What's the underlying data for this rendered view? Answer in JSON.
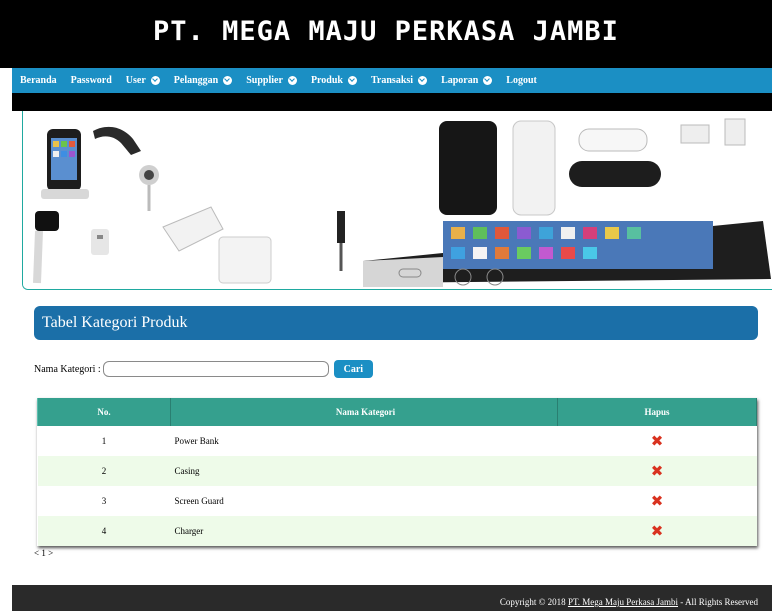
{
  "site_title": "PT. MEGA MAJU PERKASA JAMBI",
  "nav": [
    {
      "label": "Beranda",
      "dropdown": false
    },
    {
      "label": "Password",
      "dropdown": false
    },
    {
      "label": "User",
      "dropdown": true
    },
    {
      "label": "Pelanggan",
      "dropdown": true
    },
    {
      "label": "Supplier",
      "dropdown": true
    },
    {
      "label": "Produk",
      "dropdown": true
    },
    {
      "label": "Transaksi",
      "dropdown": true
    },
    {
      "label": "Laporan",
      "dropdown": true
    },
    {
      "label": "Logout",
      "dropdown": false
    }
  ],
  "panel_title": "Tabel Kategori Produk",
  "search": {
    "label": "Nama Kategori :",
    "value": "",
    "button": "Cari"
  },
  "table": {
    "headers": [
      "No.",
      "Nama Kategori",
      "Hapus"
    ],
    "rows": [
      {
        "no": "1",
        "name": "Power Bank"
      },
      {
        "no": "2",
        "name": "Casing"
      },
      {
        "no": "3",
        "name": "Screen Guard"
      },
      {
        "no": "4",
        "name": "Charger"
      }
    ]
  },
  "pager": "< 1 >",
  "footer": {
    "prefix": "Copyright © 2018 ",
    "link": "PT. Mega Maju Perkasa Jambi",
    "suffix": " - All Rights Reserved"
  },
  "colors": {
    "nav": "#1b8fc4",
    "panel": "#1b6fa8",
    "table_header": "#35a08e",
    "delete": "#d9321f"
  }
}
